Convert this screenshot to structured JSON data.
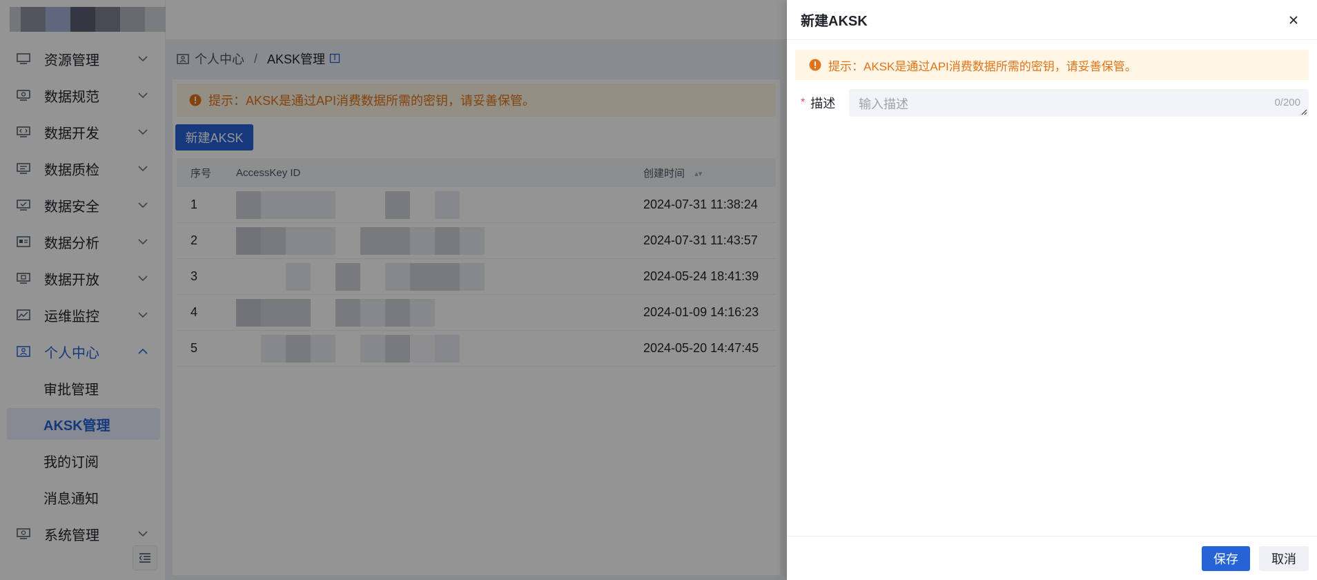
{
  "colors": {
    "accent": "#2563d6",
    "warning": "#e37318",
    "warning_bg": "#fff6e5",
    "required": "#e34d59"
  },
  "sidebar": {
    "items": [
      {
        "label": "资源管理",
        "icon": "monitor-icon",
        "expanded": false
      },
      {
        "label": "数据规范",
        "icon": "standard-icon",
        "expanded": false
      },
      {
        "label": "数据开发",
        "icon": "dev-icon",
        "expanded": false
      },
      {
        "label": "数据质检",
        "icon": "quality-icon",
        "expanded": false
      },
      {
        "label": "数据安全",
        "icon": "security-icon",
        "expanded": false
      },
      {
        "label": "数据分析",
        "icon": "analysis-icon",
        "expanded": false
      },
      {
        "label": "数据开放",
        "icon": "open-icon",
        "expanded": false
      },
      {
        "label": "运维监控",
        "icon": "monitor-chart-icon",
        "expanded": false
      },
      {
        "label": "个人中心",
        "icon": "user-center-icon",
        "expanded": true
      },
      {
        "label": "系统管理",
        "icon": "settings-icon",
        "expanded": false
      }
    ],
    "sub_items": [
      {
        "label": "审批管理"
      },
      {
        "label": "AKSK管理"
      },
      {
        "label": "我的订阅"
      },
      {
        "label": "消息通知"
      }
    ]
  },
  "breadcrumb": {
    "root": "个人中心",
    "separator": "/",
    "current": "AKSK管理"
  },
  "main": {
    "tip": "提示：AKSK是通过API消费数据所需的密钥，请妥善保管。",
    "new_button": "新建AKSK",
    "table": {
      "headers": [
        "序号",
        "AccessKey ID",
        "创建时间"
      ],
      "rows": [
        {
          "no": "1",
          "time": "2024-07-31 11:38:24"
        },
        {
          "no": "2",
          "time": "2024-07-31 11:43:57"
        },
        {
          "no": "3",
          "time": "2024-05-24 18:41:39"
        },
        {
          "no": "4",
          "time": "2024-01-09 14:16:23"
        },
        {
          "no": "5",
          "time": "2024-05-20 14:47:45"
        }
      ]
    }
  },
  "drawer": {
    "title": "新建AKSK",
    "tip": "提示：AKSK是通过API消费数据所需的密钥，请妥善保管。",
    "desc_label": "描述",
    "desc_required": "*",
    "desc_placeholder": "输入描述",
    "desc_value": "",
    "desc_counter": "0/200",
    "save_label": "保存",
    "cancel_label": "取消"
  }
}
